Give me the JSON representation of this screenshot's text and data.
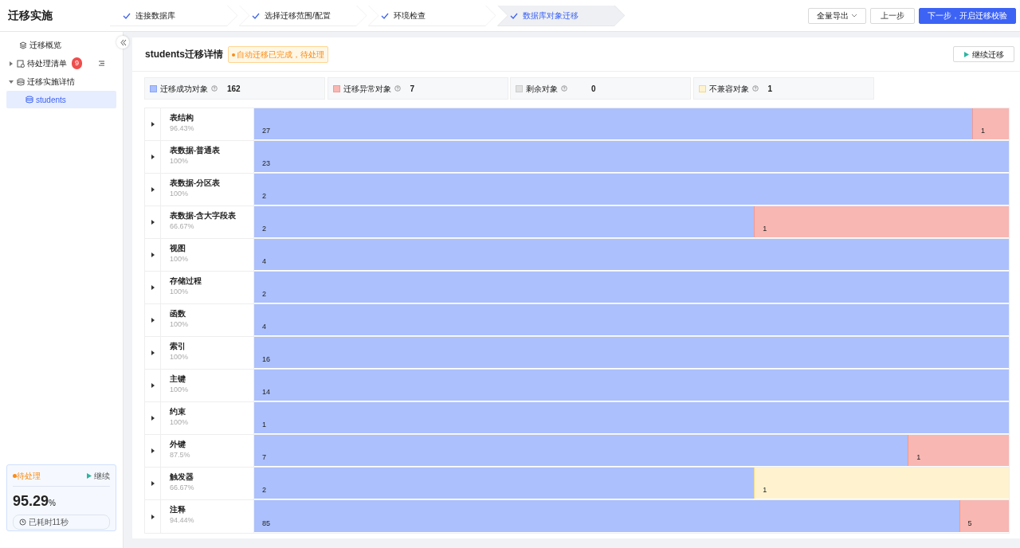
{
  "header": {
    "title": "迁移实施",
    "steps": [
      {
        "label": "连接数据库",
        "done": true,
        "selected": false
      },
      {
        "label": "选择迁移范围/配置",
        "done": true,
        "selected": false
      },
      {
        "label": "环境检查",
        "done": true,
        "selected": false
      },
      {
        "label": "数据库对象迁移",
        "done": true,
        "selected": true
      }
    ],
    "buttons": [
      {
        "label": "全量导出",
        "kind": "dropdown"
      },
      {
        "label": "上一步",
        "kind": "default"
      },
      {
        "label": "下一步，开启迁移校验",
        "kind": "primary"
      }
    ]
  },
  "sidebar": {
    "items": [
      {
        "label": "迁移概览",
        "kind": "link",
        "selected": false
      },
      {
        "label": "待处理清单",
        "kind": "group",
        "expanded": false,
        "badge": "9",
        "selected": false
      },
      {
        "label": "迁移实施详情",
        "kind": "group",
        "expanded": true,
        "selected": false,
        "children": [
          {
            "label": "students",
            "selected": true
          }
        ]
      }
    ],
    "status_card": {
      "status": "待处理",
      "action": "继续",
      "percent": "95.29",
      "unit": "%",
      "elapsed": "已耗时11秒"
    }
  },
  "detail": {
    "title": "students迁移详情",
    "status_tag": "自动迁移已完成，待处理",
    "action": "继续迁移",
    "legend": [
      {
        "label": "迁移成功对象",
        "kind": "success",
        "count": "162"
      },
      {
        "label": "迁移异常对象",
        "kind": "error",
        "count": "7"
      },
      {
        "label": "剩余对象",
        "kind": "remaining",
        "count": "0"
      },
      {
        "label": "不兼容对象",
        "kind": "incompatible",
        "count": "1"
      }
    ],
    "rows": [
      {
        "name": "表结构",
        "percent": "96.43%",
        "segments": [
          {
            "kind": "success",
            "value": "27"
          },
          {
            "kind": "error",
            "value": "1"
          }
        ]
      },
      {
        "name": "表数据-普通表",
        "percent": "100%",
        "segments": [
          {
            "kind": "success",
            "value": "23"
          }
        ]
      },
      {
        "name": "表数据-分区表",
        "percent": "100%",
        "segments": [
          {
            "kind": "success",
            "value": "2"
          }
        ]
      },
      {
        "name": "表数据-含大字段表",
        "percent": "66.67%",
        "segments": [
          {
            "kind": "success",
            "value": "2"
          },
          {
            "kind": "error",
            "value": "1"
          }
        ]
      },
      {
        "name": "视图",
        "percent": "100%",
        "segments": [
          {
            "kind": "success",
            "value": "4"
          }
        ]
      },
      {
        "name": "存储过程",
        "percent": "100%",
        "segments": [
          {
            "kind": "success",
            "value": "2"
          }
        ]
      },
      {
        "name": "函数",
        "percent": "100%",
        "segments": [
          {
            "kind": "success",
            "value": "4"
          }
        ]
      },
      {
        "name": "索引",
        "percent": "100%",
        "segments": [
          {
            "kind": "success",
            "value": "16"
          }
        ]
      },
      {
        "name": "主键",
        "percent": "100%",
        "segments": [
          {
            "kind": "success",
            "value": "14"
          }
        ]
      },
      {
        "name": "约束",
        "percent": "100%",
        "segments": [
          {
            "kind": "success",
            "value": "1"
          }
        ]
      },
      {
        "name": "外键",
        "percent": "87.5%",
        "segments": [
          {
            "kind": "success",
            "value": "7"
          },
          {
            "kind": "error",
            "value": "1"
          }
        ]
      },
      {
        "name": "触发器",
        "percent": "66.67%",
        "segments": [
          {
            "kind": "success",
            "value": "2"
          },
          {
            "kind": "incompatible",
            "value": "1"
          }
        ]
      },
      {
        "name": "注释",
        "percent": "94.44%",
        "segments": [
          {
            "kind": "success",
            "value": "85"
          },
          {
            "kind": "error",
            "value": "5"
          }
        ]
      }
    ]
  }
}
